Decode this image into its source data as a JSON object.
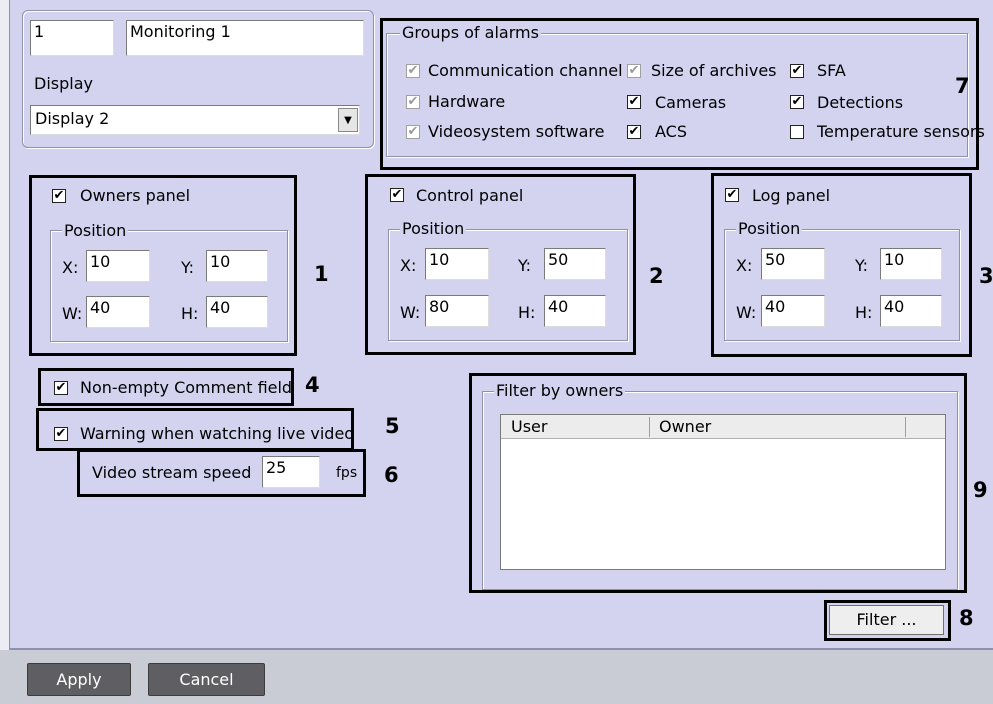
{
  "monitor": {
    "id": "1",
    "name": "Monitoring 1",
    "display_label": "Display",
    "display_value": "Display 2"
  },
  "alarms": {
    "title": "Groups of alarms",
    "items": [
      {
        "label": "Communication channel",
        "checked": true,
        "enabled": false
      },
      {
        "label": "Size of archives",
        "checked": true,
        "enabled": false
      },
      {
        "label": "SFA",
        "checked": true,
        "enabled": true
      },
      {
        "label": "Hardware",
        "checked": true,
        "enabled": false
      },
      {
        "label": "Cameras",
        "checked": true,
        "enabled": true
      },
      {
        "label": "Detections",
        "checked": true,
        "enabled": true
      },
      {
        "label": "Videosystem software",
        "checked": true,
        "enabled": false
      },
      {
        "label": "ACS",
        "checked": true,
        "enabled": true
      },
      {
        "label": "Temperature sensors",
        "checked": false,
        "enabled": true
      }
    ]
  },
  "panels": {
    "owners": {
      "label": "Owners panel",
      "checked": true,
      "position_label": "Position",
      "x_label": "X:",
      "y_label": "Y:",
      "w_label": "W:",
      "h_label": "H:",
      "x": "10",
      "y": "10",
      "w": "40",
      "h": "40"
    },
    "control": {
      "label": "Control panel",
      "checked": true,
      "position_label": "Position",
      "x_label": "X:",
      "y_label": "Y:",
      "w_label": "W:",
      "h_label": "H:",
      "x": "10",
      "y": "50",
      "w": "80",
      "h": "40"
    },
    "log": {
      "label": "Log panel",
      "checked": true,
      "position_label": "Position",
      "x_label": "X:",
      "y_label": "Y:",
      "w_label": "W:",
      "h_label": "H:",
      "x": "50",
      "y": "10",
      "w": "40",
      "h": "40"
    }
  },
  "options": {
    "non_empty_comment": {
      "label": "Non-empty Comment field",
      "checked": true
    },
    "warning_live": {
      "label": "Warning when watching live video",
      "checked": true
    },
    "video_speed": {
      "label": "Video stream speed",
      "value": "25",
      "unit": "fps"
    }
  },
  "filter": {
    "title": "Filter by owners",
    "columns": [
      "User",
      "Owner"
    ],
    "button": "Filter ..."
  },
  "callouts": {
    "n1": "1",
    "n2": "2",
    "n3": "3",
    "n4": "4",
    "n5": "5",
    "n6": "6",
    "n7": "7",
    "n8": "8",
    "n9": "9"
  },
  "footer": {
    "apply": "Apply",
    "cancel": "Cancel"
  },
  "check_mark": "✔"
}
